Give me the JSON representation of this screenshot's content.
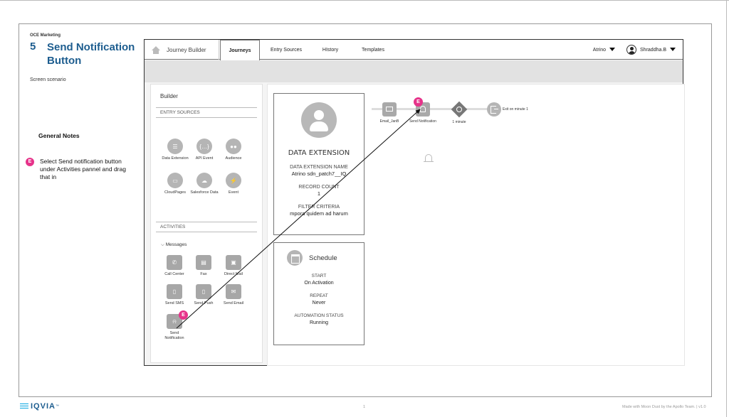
{
  "slide": {
    "project": "OCE Marketing",
    "number": "5",
    "title": "Send Notification Button",
    "scenario": "Screen scenario",
    "notes_title": "General Notes",
    "note_badge": "E",
    "note_text": "Select Send notification button under Activities pannel and drag that in"
  },
  "app": {
    "home_label": "Journey Builder",
    "tabs": [
      {
        "label": "Journeys",
        "active": true
      },
      {
        "label": "Entry Sources",
        "active": false
      },
      {
        "label": "HIstory",
        "active": false
      },
      {
        "label": "Templates",
        "active": false
      }
    ],
    "org_name": "Atrino",
    "user_name": "Shraddha.B"
  },
  "builder": {
    "title": "Builder",
    "entry_sources_label": "ENTRY SOURCES",
    "entry_sources": [
      {
        "label": "Data Extension",
        "icon": "data-extension-icon",
        "glyph": "☰"
      },
      {
        "label": "API Event",
        "icon": "api-event-icon",
        "glyph": "{…}"
      },
      {
        "label": "Audience",
        "icon": "audience-icon",
        "glyph": "●●"
      },
      {
        "label": "CloudPages",
        "icon": "cloudpages-icon",
        "glyph": "▭"
      },
      {
        "label": "Salesforce Data",
        "icon": "salesforce-cloud-icon",
        "glyph": "☁"
      },
      {
        "label": "Event",
        "icon": "event-bolt-icon",
        "glyph": "⚡"
      }
    ],
    "activities_label": "ACTIVITIES",
    "messages_label": "Messages",
    "activities": [
      {
        "label": "Call Center",
        "icon": "phone-icon",
        "glyph": "✆"
      },
      {
        "label": "Fax",
        "icon": "fax-icon",
        "glyph": "▤"
      },
      {
        "label": "Direct Mail",
        "icon": "direct-mail-icon",
        "glyph": "▣"
      },
      {
        "label": "Send SMS",
        "icon": "sms-icon",
        "glyph": "▯"
      },
      {
        "label": "Send Push",
        "icon": "push-icon",
        "glyph": "▯"
      },
      {
        "label": "Send Email",
        "icon": "email-icon",
        "glyph": "✉"
      },
      {
        "label": "Send Notification",
        "icon": "bell-icon",
        "glyph": "⍾"
      }
    ],
    "badge": "E"
  },
  "canvas": {
    "data_extension": {
      "title": "DATA EXTENSION",
      "name_label": "DATA EXTENSION NAME",
      "name_value": "Atrino sdn_patch7__IQ",
      "count_label": "RECORD COUNT",
      "count_value": "1",
      "filter_label": "FILTER CRITERIA",
      "filter_value": "mpora quidem ad harum"
    },
    "schedule": {
      "title": "Schedule",
      "start_label": "START",
      "start_value": "On Activation",
      "repeat_label": "REPEAT",
      "repeat_value": "Never",
      "status_label": "AUTOMATION STATUS",
      "status_value": "Running"
    },
    "flow": {
      "email_label": "Email_JanB",
      "notification_label": "Send Notification",
      "wait_label": "1 minute",
      "exit_label": "Exit on minute 1",
      "badge": "E"
    }
  },
  "footer": {
    "logo": "IQVIA",
    "tm": "™",
    "page": "1",
    "credit": "Made with Moon Dust by the Apollo Team. | v1.0"
  },
  "colors": {
    "title_blue": "#1d5d8f",
    "badge_pink": "#e6338a",
    "arrow": "#111111"
  }
}
